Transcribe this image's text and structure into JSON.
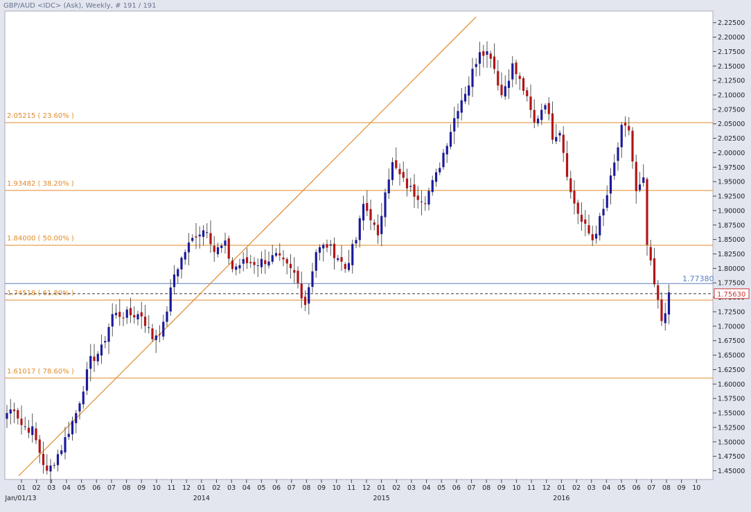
{
  "header": {
    "title": "GBP/AUD <IDC> (Ask), Weekly, # 191 / 191"
  },
  "colors": {
    "background": "#e3e6ef",
    "plot_bg": "#ffffff",
    "bull": "#1a1a9c",
    "bear": "#b01515",
    "wick": "#555555",
    "fib_line": "#e08a2a",
    "trend_line": "#e08a2a",
    "resistance_line": "#5b7fc0",
    "current_price_box": "#c83232"
  },
  "chart_data": {
    "type": "candlestick",
    "title": "GBP/AUD <IDC> (Ask), Weekly, # 191 / 191",
    "xlabel": "",
    "ylabel": "",
    "ylim": [
      1.435,
      2.245
    ],
    "grid": false,
    "y_ticks": [
      "1.45000",
      "1.47500",
      "1.50000",
      "1.52500",
      "1.55000",
      "1.57500",
      "1.60000",
      "1.62500",
      "1.65000",
      "1.67500",
      "1.70000",
      "1.72500",
      "1.75000",
      "1.77500",
      "1.80000",
      "1.82500",
      "1.85000",
      "1.87500",
      "1.90000",
      "1.92500",
      "1.95000",
      "1.97500",
      "2.00000",
      "2.02500",
      "2.05000",
      "2.07500",
      "2.10000",
      "2.12500",
      "2.15000",
      "2.17500",
      "2.20000",
      "2.22500"
    ],
    "x_month_labels": [
      "01",
      "02",
      "03",
      "04",
      "05",
      "06",
      "07",
      "08",
      "09",
      "10",
      "11",
      "12",
      "01",
      "02",
      "03",
      "04",
      "05",
      "06",
      "07",
      "08",
      "09",
      "10",
      "11",
      "12",
      "01",
      "02",
      "03",
      "04",
      "05",
      "06",
      "07",
      "08",
      "09",
      "10",
      "11",
      "12",
      "01",
      "02",
      "03",
      "04",
      "05",
      "06",
      "07",
      "08",
      "09",
      "10"
    ],
    "x_year_labels": [
      {
        "label": "Jan/01/13",
        "month_index": 0
      },
      {
        "label": "2014",
        "month_index": 12
      },
      {
        "label": "2015",
        "month_index": 24
      },
      {
        "label": "2016",
        "month_index": 36
      }
    ],
    "fib_levels": [
      {
        "value": 2.05215,
        "label": "2.05215 ( 23.60% )"
      },
      {
        "value": 1.93482,
        "label": "1.93482 ( 38.20% )"
      },
      {
        "value": 1.84,
        "label": "1.84000 ( 50.00% )"
      },
      {
        "value": 1.74518,
        "label": "1.74518 ( 61.80% )"
      },
      {
        "value": 1.61017,
        "label": "1.61017 ( 78.60% )"
      }
    ],
    "resistance": {
      "value": 1.7738,
      "label": "1.77380"
    },
    "current_price": {
      "value": 1.7563,
      "label": "1.75630"
    },
    "trend_line": {
      "from": {
        "week": 3.2,
        "price": 1.441
      },
      "to": {
        "week": 129,
        "price": 2.235
      }
    },
    "anchors": [
      {
        "week": 0,
        "price": 1.55
      },
      {
        "week": 2,
        "price": 1.56
      },
      {
        "week": 4,
        "price": 1.53
      },
      {
        "week": 7,
        "price": 1.52
      },
      {
        "week": 11,
        "price": 1.445
      },
      {
        "week": 15,
        "price": 1.49
      },
      {
        "week": 19,
        "price": 1.55
      },
      {
        "week": 23,
        "price": 1.64
      },
      {
        "week": 26,
        "price": 1.66
      },
      {
        "week": 29,
        "price": 1.72
      },
      {
        "week": 33,
        "price": 1.72
      },
      {
        "week": 37,
        "price": 1.72
      },
      {
        "week": 40,
        "price": 1.68
      },
      {
        "week": 43,
        "price": 1.7
      },
      {
        "week": 46,
        "price": 1.79
      },
      {
        "week": 49,
        "price": 1.83
      },
      {
        "week": 52,
        "price": 1.86
      },
      {
        "week": 55,
        "price": 1.87
      },
      {
        "week": 57,
        "price": 1.83
      },
      {
        "week": 60,
        "price": 1.84
      },
      {
        "week": 62,
        "price": 1.8
      },
      {
        "week": 65,
        "price": 1.81
      },
      {
        "week": 69,
        "price": 1.81
      },
      {
        "week": 74,
        "price": 1.82
      },
      {
        "week": 79,
        "price": 1.79
      },
      {
        "week": 82,
        "price": 1.74
      },
      {
        "week": 85,
        "price": 1.83
      },
      {
        "week": 88,
        "price": 1.84
      },
      {
        "week": 91,
        "price": 1.82
      },
      {
        "week": 93,
        "price": 1.8
      },
      {
        "week": 96,
        "price": 1.85
      },
      {
        "week": 98,
        "price": 1.91
      },
      {
        "week": 100,
        "price": 1.89
      },
      {
        "week": 102,
        "price": 1.85
      },
      {
        "week": 104,
        "price": 1.94
      },
      {
        "week": 106,
        "price": 1.98
      },
      {
        "week": 109,
        "price": 1.95
      },
      {
        "week": 112,
        "price": 1.93
      },
      {
        "week": 115,
        "price": 1.92
      },
      {
        "week": 118,
        "price": 1.96
      },
      {
        "week": 121,
        "price": 2.02
      },
      {
        "week": 124,
        "price": 2.08
      },
      {
        "week": 127,
        "price": 2.12
      },
      {
        "week": 130,
        "price": 2.18
      },
      {
        "week": 133,
        "price": 2.17
      },
      {
        "week": 136,
        "price": 2.1
      },
      {
        "week": 139,
        "price": 2.15
      },
      {
        "week": 142,
        "price": 2.11
      },
      {
        "week": 145,
        "price": 2.05
      },
      {
        "week": 148,
        "price": 2.09
      },
      {
        "week": 150,
        "price": 2.03
      },
      {
        "week": 152,
        "price": 2.04
      },
      {
        "week": 155,
        "price": 1.93
      },
      {
        "week": 158,
        "price": 1.88
      },
      {
        "week": 161,
        "price": 1.85
      },
      {
        "week": 164,
        "price": 1.9
      },
      {
        "week": 167,
        "price": 1.98
      },
      {
        "week": 169,
        "price": 2.04
      },
      {
        "week": 171,
        "price": 2.04
      },
      {
        "week": 173,
        "price": 1.93
      },
      {
        "week": 175,
        "price": 1.95
      },
      {
        "week": 176,
        "price": 1.84
      },
      {
        "week": 178,
        "price": 1.77
      },
      {
        "week": 180,
        "price": 1.71
      },
      {
        "week": 181,
        "price": 1.73
      },
      {
        "week": 182,
        "price": 1.75
      }
    ]
  }
}
